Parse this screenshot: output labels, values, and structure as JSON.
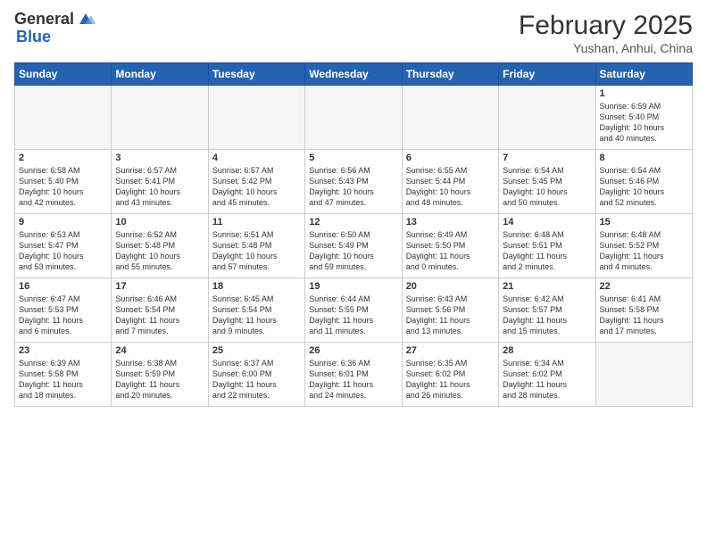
{
  "header": {
    "logo_general": "General",
    "logo_blue": "Blue",
    "title": "February 2025",
    "subtitle": "Yushan, Anhui, China"
  },
  "weekdays": [
    "Sunday",
    "Monday",
    "Tuesday",
    "Wednesday",
    "Thursday",
    "Friday",
    "Saturday"
  ],
  "weeks": [
    [
      {
        "day": "",
        "detail": "",
        "empty": true
      },
      {
        "day": "",
        "detail": "",
        "empty": true
      },
      {
        "day": "",
        "detail": "",
        "empty": true
      },
      {
        "day": "",
        "detail": "",
        "empty": true
      },
      {
        "day": "",
        "detail": "",
        "empty": true
      },
      {
        "day": "",
        "detail": "",
        "empty": true
      },
      {
        "day": "1",
        "detail": "Sunrise: 6:59 AM\nSunset: 5:40 PM\nDaylight: 10 hours\nand 40 minutes."
      }
    ],
    [
      {
        "day": "2",
        "detail": "Sunrise: 6:58 AM\nSunset: 5:40 PM\nDaylight: 10 hours\nand 42 minutes."
      },
      {
        "day": "3",
        "detail": "Sunrise: 6:57 AM\nSunset: 5:41 PM\nDaylight: 10 hours\nand 43 minutes."
      },
      {
        "day": "4",
        "detail": "Sunrise: 6:57 AM\nSunset: 5:42 PM\nDaylight: 10 hours\nand 45 minutes."
      },
      {
        "day": "5",
        "detail": "Sunrise: 6:56 AM\nSunset: 5:43 PM\nDaylight: 10 hours\nand 47 minutes."
      },
      {
        "day": "6",
        "detail": "Sunrise: 6:55 AM\nSunset: 5:44 PM\nDaylight: 10 hours\nand 48 minutes."
      },
      {
        "day": "7",
        "detail": "Sunrise: 6:54 AM\nSunset: 5:45 PM\nDaylight: 10 hours\nand 50 minutes."
      },
      {
        "day": "8",
        "detail": "Sunrise: 6:54 AM\nSunset: 5:46 PM\nDaylight: 10 hours\nand 52 minutes."
      }
    ],
    [
      {
        "day": "9",
        "detail": "Sunrise: 6:53 AM\nSunset: 5:47 PM\nDaylight: 10 hours\nand 53 minutes."
      },
      {
        "day": "10",
        "detail": "Sunrise: 6:52 AM\nSunset: 5:48 PM\nDaylight: 10 hours\nand 55 minutes."
      },
      {
        "day": "11",
        "detail": "Sunrise: 6:51 AM\nSunset: 5:48 PM\nDaylight: 10 hours\nand 57 minutes."
      },
      {
        "day": "12",
        "detail": "Sunrise: 6:50 AM\nSunset: 5:49 PM\nDaylight: 10 hours\nand 59 minutes."
      },
      {
        "day": "13",
        "detail": "Sunrise: 6:49 AM\nSunset: 5:50 PM\nDaylight: 11 hours\nand 0 minutes."
      },
      {
        "day": "14",
        "detail": "Sunrise: 6:48 AM\nSunset: 5:51 PM\nDaylight: 11 hours\nand 2 minutes."
      },
      {
        "day": "15",
        "detail": "Sunrise: 6:48 AM\nSunset: 5:52 PM\nDaylight: 11 hours\nand 4 minutes."
      }
    ],
    [
      {
        "day": "16",
        "detail": "Sunrise: 6:47 AM\nSunset: 5:53 PM\nDaylight: 11 hours\nand 6 minutes."
      },
      {
        "day": "17",
        "detail": "Sunrise: 6:46 AM\nSunset: 5:54 PM\nDaylight: 11 hours\nand 7 minutes."
      },
      {
        "day": "18",
        "detail": "Sunrise: 6:45 AM\nSunset: 5:54 PM\nDaylight: 11 hours\nand 9 minutes."
      },
      {
        "day": "19",
        "detail": "Sunrise: 6:44 AM\nSunset: 5:55 PM\nDaylight: 11 hours\nand 11 minutes."
      },
      {
        "day": "20",
        "detail": "Sunrise: 6:43 AM\nSunset: 5:56 PM\nDaylight: 11 hours\nand 13 minutes."
      },
      {
        "day": "21",
        "detail": "Sunrise: 6:42 AM\nSunset: 5:57 PM\nDaylight: 11 hours\nand 15 minutes."
      },
      {
        "day": "22",
        "detail": "Sunrise: 6:41 AM\nSunset: 5:58 PM\nDaylight: 11 hours\nand 17 minutes."
      }
    ],
    [
      {
        "day": "23",
        "detail": "Sunrise: 6:39 AM\nSunset: 5:58 PM\nDaylight: 11 hours\nand 18 minutes."
      },
      {
        "day": "24",
        "detail": "Sunrise: 6:38 AM\nSunset: 5:59 PM\nDaylight: 11 hours\nand 20 minutes."
      },
      {
        "day": "25",
        "detail": "Sunrise: 6:37 AM\nSunset: 6:00 PM\nDaylight: 11 hours\nand 22 minutes."
      },
      {
        "day": "26",
        "detail": "Sunrise: 6:36 AM\nSunset: 6:01 PM\nDaylight: 11 hours\nand 24 minutes."
      },
      {
        "day": "27",
        "detail": "Sunrise: 6:35 AM\nSunset: 6:02 PM\nDaylight: 11 hours\nand 26 minutes."
      },
      {
        "day": "28",
        "detail": "Sunrise: 6:34 AM\nSunset: 6:02 PM\nDaylight: 11 hours\nand 28 minutes."
      },
      {
        "day": "",
        "detail": "",
        "empty": true
      }
    ]
  ]
}
